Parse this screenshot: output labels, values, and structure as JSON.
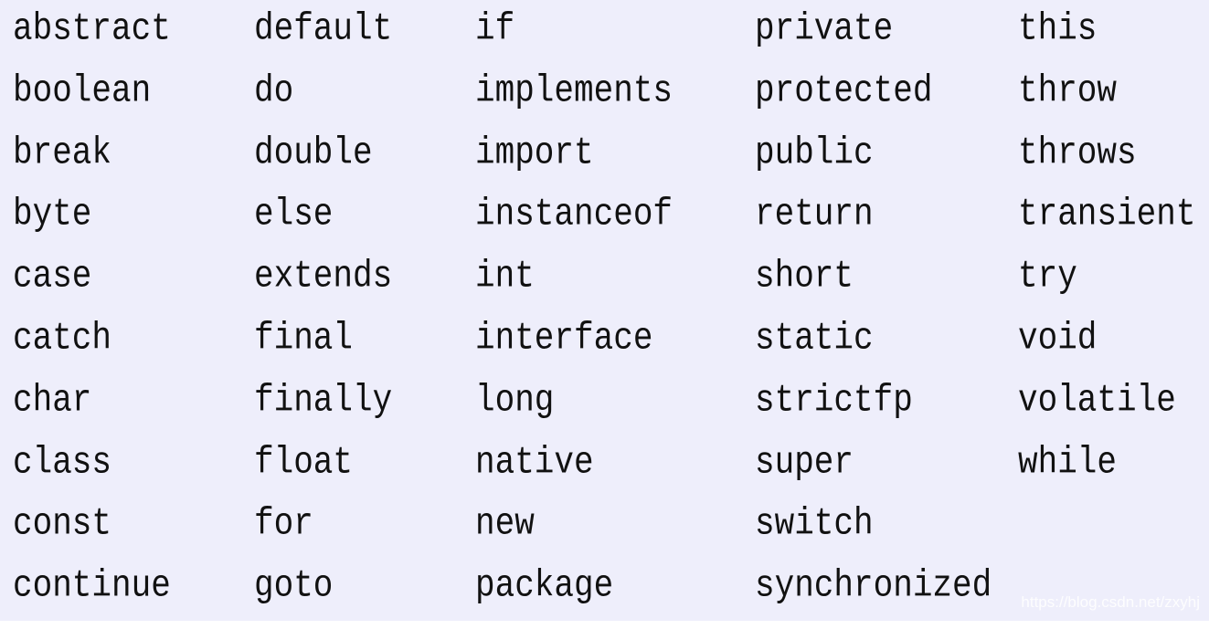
{
  "columns": [
    [
      "abstract",
      "boolean",
      "break",
      "byte",
      "case",
      "catch",
      "char",
      "class",
      "const",
      "continue"
    ],
    [
      "default",
      "do",
      "double",
      "else",
      "extends",
      "final",
      "finally",
      "float",
      "for",
      "goto"
    ],
    [
      "if",
      "implements",
      "import",
      "instanceof",
      "int",
      "interface",
      "long",
      "native",
      "new",
      "package"
    ],
    [
      "private",
      "protected",
      "public",
      "return",
      "short",
      "static",
      "strictfp",
      "super",
      "switch",
      "synchronized"
    ],
    [
      "this",
      "throw",
      "throws",
      "transient",
      "try",
      "void",
      "volatile",
      "while"
    ]
  ],
  "watermark": "https://blog.csdn.net/zxyhj",
  "colors": {
    "background": "#eeeefb",
    "text": "#111111"
  }
}
